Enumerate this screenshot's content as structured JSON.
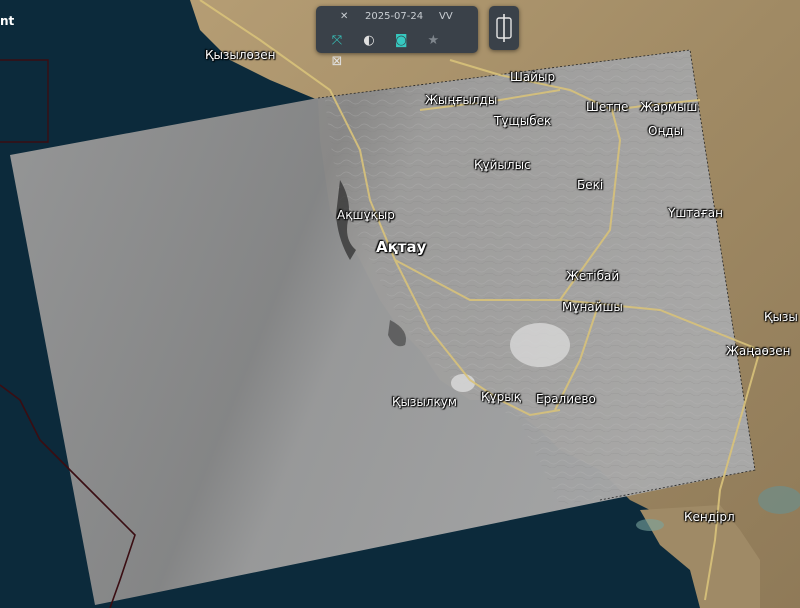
{
  "toolbar": {
    "date": "2025-07-24",
    "polarization": "VV",
    "icons": [
      "satellite-icon",
      "layers-icon",
      "camera-icon",
      "star-icon",
      "close-box-icon"
    ],
    "accent_color": "#36c9c0"
  },
  "edge_label": "nt",
  "places": [
    {
      "name": "Қызылөзен",
      "type": "town"
    },
    {
      "name": "Шайыр",
      "type": "town"
    },
    {
      "name": "Жыңғылды",
      "type": "town"
    },
    {
      "name": "Шетпе",
      "type": "town"
    },
    {
      "name": "Жармыш",
      "type": "town"
    },
    {
      "name": "Тұщыбек",
      "type": "town"
    },
    {
      "name": "Оңды",
      "type": "town"
    },
    {
      "name": "Құйылыс",
      "type": "town"
    },
    {
      "name": "Бекі",
      "type": "town"
    },
    {
      "name": "Үштаған",
      "type": "town"
    },
    {
      "name": "Ақшұқыр",
      "type": "town"
    },
    {
      "name": "Ақтау",
      "type": "city"
    },
    {
      "name": "Жетібай",
      "type": "town"
    },
    {
      "name": "Мұнайшы",
      "type": "town"
    },
    {
      "name": "Қызы",
      "type": "town"
    },
    {
      "name": "Жаңаөзен",
      "type": "town"
    },
    {
      "name": "Қызылкум",
      "type": "town"
    },
    {
      "name": "Құрық",
      "type": "town"
    },
    {
      "name": "Ералиево",
      "type": "town"
    },
    {
      "name": "Кендірл",
      "type": "town"
    }
  ],
  "colors": {
    "sea": "#0c2a3b",
    "land": "#a89370",
    "sar_overlay": "#8e8e8e",
    "road": "#d8c27a",
    "border": "#3a0d12"
  }
}
